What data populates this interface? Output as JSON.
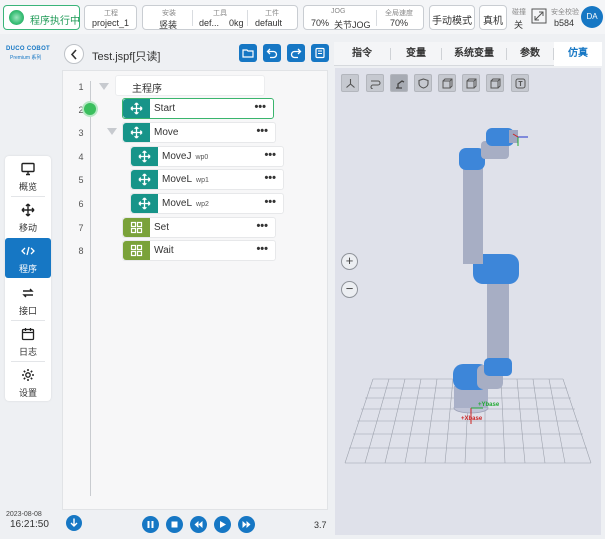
{
  "topbar": {
    "status": "程序执行中",
    "project": {
      "label": "工程",
      "value": "project_1"
    },
    "install": {
      "label": "安装",
      "value": "竖装"
    },
    "tool": {
      "label": "工具",
      "value": "def...",
      "weight": "0kg"
    },
    "workpiece": {
      "label": "工件",
      "value": "default"
    },
    "jog": {
      "label": "JOG",
      "speed": "70%",
      "mode": "关节JOG"
    },
    "global_speed": {
      "label": "全局速度",
      "value": "70%"
    },
    "manual_mode": "手动模式",
    "real_machine": "真机",
    "collision": {
      "label": "碰撞",
      "value": "关"
    },
    "safety": {
      "label": "安全校验",
      "value": "b584"
    },
    "avatar": "DA"
  },
  "logo": {
    "main": "DUCO COBOT",
    "sub": "Premium 系列"
  },
  "sidebar": {
    "items": [
      {
        "label": "概览",
        "icon": "monitor-icon"
      },
      {
        "label": "移动",
        "icon": "move-icon"
      },
      {
        "label": "程序",
        "icon": "code-icon"
      },
      {
        "label": "接口",
        "icon": "interface-icon"
      },
      {
        "label": "日志",
        "icon": "calendar-icon"
      },
      {
        "label": "设置",
        "icon": "gear-icon"
      }
    ],
    "active": "程序"
  },
  "clock": {
    "date": "2023-08-08",
    "time": "16:21:50"
  },
  "program": {
    "file_title": "Test.jspf[只读]",
    "root_label": "主程序",
    "lines": [
      {
        "num": "1"
      },
      {
        "num": "2",
        "label": "Start",
        "sub": ""
      },
      {
        "num": "3",
        "label": "Move",
        "sub": ""
      },
      {
        "num": "4",
        "label": "MoveJ",
        "sub": "wp0"
      },
      {
        "num": "5",
        "label": "MoveL",
        "sub": "wp1"
      },
      {
        "num": "6",
        "label": "MoveL",
        "sub": "wp2"
      },
      {
        "num": "7",
        "label": "Set",
        "sub": ""
      },
      {
        "num": "8",
        "label": "Wait",
        "sub": ""
      }
    ],
    "dots": "•••",
    "version": "3.7"
  },
  "tabs": [
    "指令",
    "变量",
    "系统变量",
    "参数",
    "仿真"
  ],
  "active_tab": "仿真",
  "viewport": {
    "zoom_in": "+",
    "zoom_out": "−",
    "axis_x": "+Xbase",
    "axis_y": "+Ybase"
  },
  "colors": {
    "primary": "#1677c4",
    "running": "#3bbf77",
    "teal": "#179489",
    "olive": "#7aa23a",
    "robot_blue": "#3d86d9",
    "robot_grey": "#a7aec4"
  }
}
